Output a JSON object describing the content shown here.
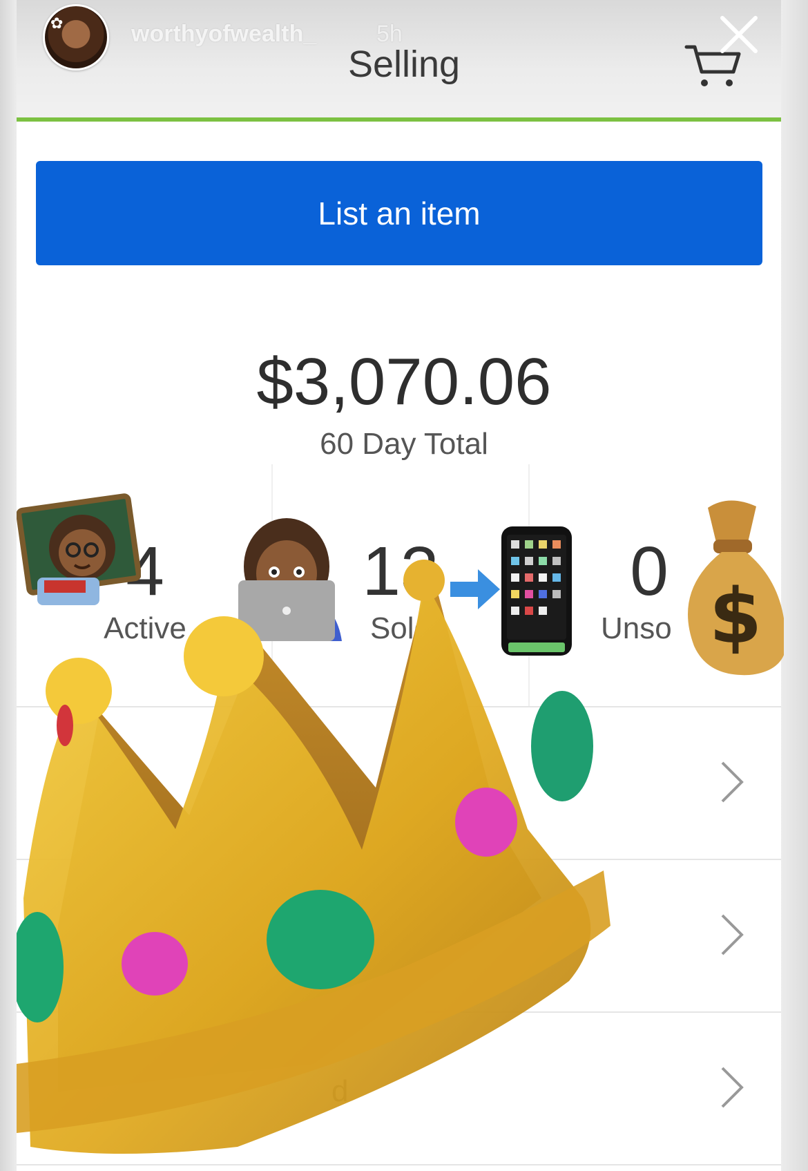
{
  "story": {
    "username": "worthyofwealth_",
    "time": "5h"
  },
  "header": {
    "title": "Selling",
    "close_icon": "close-icon",
    "cart_icon": "cart-icon",
    "accent_color": "#7cc142"
  },
  "list_button": {
    "label": "List an item",
    "color": "#0a62d8"
  },
  "summary": {
    "amount": "$3,070.06",
    "label": "60 Day Total"
  },
  "stats": [
    {
      "value": "4",
      "label": "Active"
    },
    {
      "value": "13",
      "label": "Sold"
    },
    {
      "value": "0",
      "label": "Unso"
    }
  ],
  "rows": [
    {
      "chevron_icon": "chevron-right-icon"
    },
    {
      "chevron_icon": "chevron-right-icon"
    },
    {
      "partial_text": "d",
      "chevron_icon": "chevron-right-icon"
    }
  ],
  "stickers": [
    "teacher-emoji",
    "woman-laptop-emoji",
    "arrow-right-emoji",
    "mobile-phone-emoji",
    "money-bag-emoji",
    "crown-emoji"
  ]
}
